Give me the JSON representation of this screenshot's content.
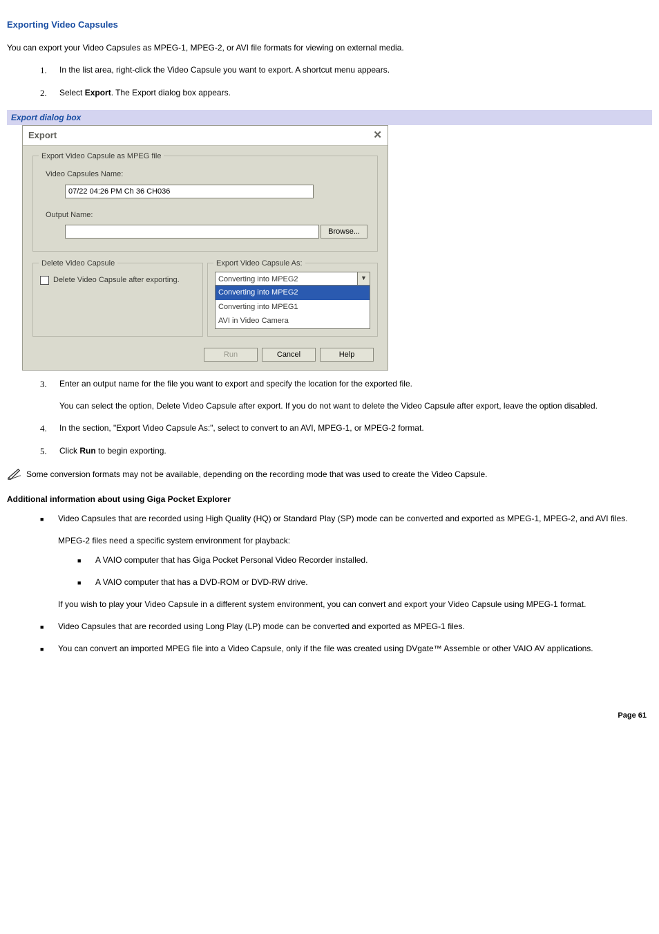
{
  "heading": "Exporting Video Capsules",
  "intro": "You can export your Video Capsules as MPEG-1, MPEG-2, or AVI file formats for viewing on external media.",
  "steps_a": [
    {
      "n": "1.",
      "text": "In the list area, right-click the Video Capsule you want to export. A shortcut menu appears."
    },
    {
      "n": "2.",
      "pre": "Select ",
      "b": "Export",
      "post": ". The Export dialog box appears."
    }
  ],
  "figcap": "Export dialog box",
  "dialog": {
    "title": "Export",
    "close": "✕",
    "group1_legend": "Export Video Capsule as MPEG file",
    "name_label": "Video Capsules Name:",
    "name_value": "07/22 04:26 PM Ch 36 CH036",
    "output_label": "Output Name:",
    "output_value": "",
    "browse": "Browse...",
    "delgroup_legend": "Delete Video Capsule",
    "del_label": "Delete Video Capsule after exporting.",
    "expgroup_legend": "Export Video Capsule As:",
    "combo_selected": "Converting into MPEG2",
    "combo_items": [
      "Converting into MPEG2",
      "Converting into MPEG1",
      "AVI in Video Camera"
    ],
    "btn_run": "Run",
    "btn_cancel": "Cancel",
    "btn_help": "Help"
  },
  "steps_b": [
    {
      "n": "3.",
      "text": "Enter an output name for the file you want to export and specify the location for the exported file.",
      "sub": "You can select the option, Delete Video Capsule after export. If you do not want to delete the Video Capsule after export, leave the option disabled."
    },
    {
      "n": "4.",
      "text": "In the section, \"Export Video Capsule As:\", select to convert to an AVI, MPEG-1, or MPEG-2 format."
    },
    {
      "n": "5.",
      "pre": "Click ",
      "b": "Run",
      "post": " to begin exporting."
    }
  ],
  "note": "Some conversion formats may not be available, depending on the recording mode that was used to create the Video Capsule.",
  "addl_heading": "Additional information about using Giga Pocket Explorer",
  "bullets": [
    {
      "text": "Video Capsules that are recorded using High Quality (HQ) or Standard Play (SP) mode can be converted and exported as MPEG-1, MPEG-2, and AVI files.",
      "sub": "MPEG-2 files need a specific system environment for playback:",
      "sub_bullets": [
        "A VAIO computer that has Giga Pocket Personal Video Recorder installed.",
        "A VAIO computer that has a DVD-ROM or DVD-RW drive."
      ],
      "sub2": "If you wish to play your Video Capsule in a different system environment, you can convert and export your Video Capsule using MPEG-1 format."
    },
    {
      "text": "Video Capsules that are recorded using Long Play (LP) mode can be converted and exported as MPEG-1 files."
    },
    {
      "text": "You can convert an imported MPEG file into a Video Capsule, only if the file was created using DVgate™ Assemble or other VAIO AV applications."
    }
  ],
  "page": "Page 61"
}
